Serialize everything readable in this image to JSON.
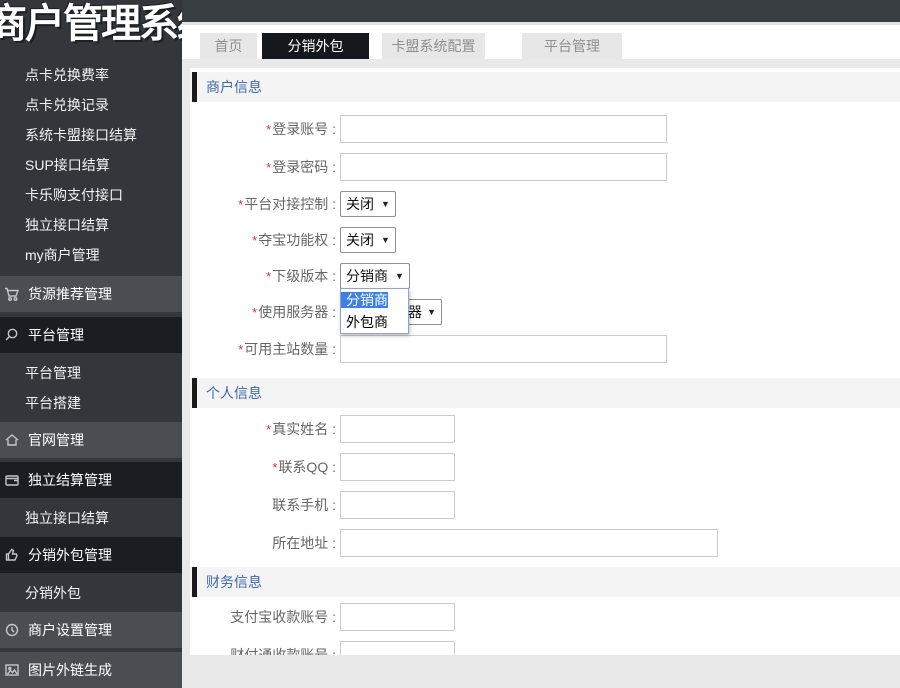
{
  "colors": {
    "sidebar_bg": "#33373b",
    "group_collapsed_bg": "#4a4e53",
    "group_expanded_bg": "#1a1d21",
    "active_tab_bg": "#14171b",
    "section_title_blue": "#3e67b0",
    "required_red": "#e03131",
    "dropdown_highlight": "#3c80e8"
  },
  "sidebar": {
    "logo": "商户管理系统",
    "items": [
      {
        "label": "点卡兑换费率",
        "type": "sub"
      },
      {
        "label": "点卡兑换记录",
        "type": "sub"
      },
      {
        "label": "系统卡盟接口结算",
        "type": "sub"
      },
      {
        "label": "SUP接口结算",
        "type": "sub"
      },
      {
        "label": "卡乐购支付接口",
        "type": "sub"
      },
      {
        "label": "独立接口结算",
        "type": "sub"
      },
      {
        "label": "my商户管理",
        "type": "sub"
      },
      {
        "label": "货源推荐管理",
        "type": "group",
        "icon": "cart-icon"
      },
      {
        "label": "平台管理",
        "type": "group-expanded",
        "icon": "search-icon"
      },
      {
        "label": "平台管理",
        "type": "sub"
      },
      {
        "label": "平台搭建",
        "type": "sub"
      },
      {
        "label": "官网管理",
        "type": "group",
        "icon": "home-icon"
      },
      {
        "label": "独立结算管理",
        "type": "group-expanded",
        "icon": "wallet-icon"
      },
      {
        "label": "独立接口结算",
        "type": "sub"
      },
      {
        "label": "分销外包管理",
        "type": "group-expanded",
        "icon": "thumbs-up-icon"
      },
      {
        "label": "分销外包",
        "type": "sub"
      },
      {
        "label": "商户设置管理",
        "type": "group",
        "icon": "clock-icon"
      },
      {
        "label": "图片外链生成",
        "type": "group",
        "icon": "image-icon"
      }
    ]
  },
  "tabs": [
    {
      "label": "首页",
      "active": false
    },
    {
      "label": "分销外包",
      "active": true
    },
    {
      "label": "卡盟系统配置",
      "active": false
    },
    {
      "label": "平台管理",
      "active": false
    }
  ],
  "form": {
    "required_marker": "*",
    "sections": [
      {
        "title": "商户信息",
        "rows": [
          {
            "label": "登录账号 :",
            "required": true,
            "control": "input",
            "value": ""
          },
          {
            "label": "登录密码 :",
            "required": true,
            "control": "input",
            "value": ""
          },
          {
            "label": "平台对接控制 :",
            "required": true,
            "control": "select",
            "value": "关闭"
          },
          {
            "label": "夺宝功能权 :",
            "required": true,
            "control": "select",
            "value": "关闭"
          },
          {
            "label": "下级版本 :",
            "required": true,
            "control": "select",
            "value": "分销商",
            "open": true
          },
          {
            "label": "使用服务器 :",
            "required": true,
            "control": "select",
            "value": "服务器"
          },
          {
            "label": "可用主站数量 :",
            "required": true,
            "control": "input",
            "value": ""
          }
        ]
      },
      {
        "title": "个人信息",
        "rows": [
          {
            "label": "真实姓名 :",
            "required": true,
            "control": "input",
            "value": ""
          },
          {
            "label": "联系QQ :",
            "required": true,
            "control": "input",
            "value": ""
          },
          {
            "label": "联系手机 :",
            "required": false,
            "control": "input",
            "value": ""
          },
          {
            "label": "所在地址 :",
            "required": false,
            "control": "input",
            "value": ""
          }
        ]
      },
      {
        "title": "财务信息",
        "rows": [
          {
            "label": "支付宝收款账号 :",
            "required": false,
            "control": "input",
            "value": ""
          },
          {
            "label": "财付通收款账号 :",
            "required": false,
            "control": "input",
            "value": ""
          }
        ]
      }
    ]
  },
  "dropdown": {
    "select_arrow": "▼",
    "options": [
      {
        "label": "分销商",
        "highlighted": true
      },
      {
        "label": "外包商",
        "highlighted": false
      }
    ]
  }
}
